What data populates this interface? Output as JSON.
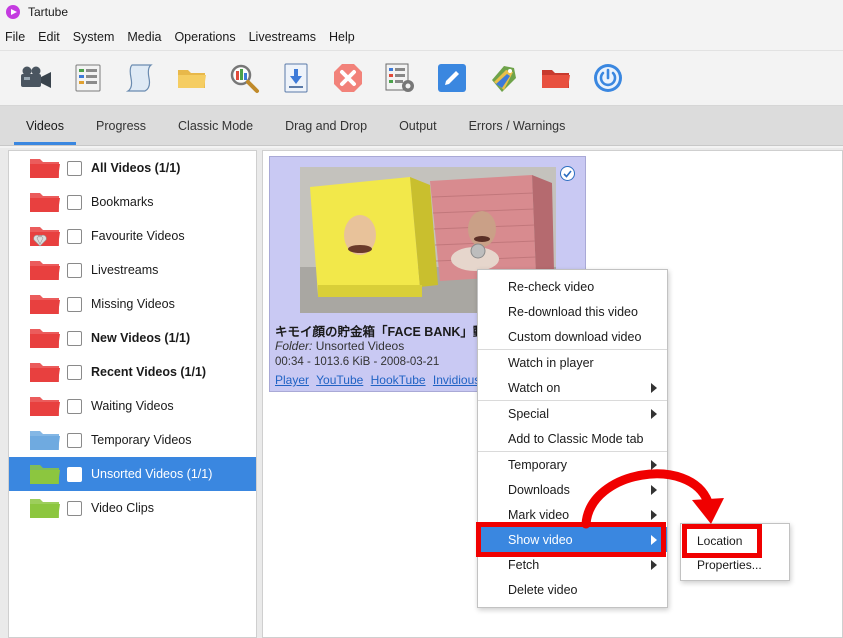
{
  "window": {
    "title": "Tartube"
  },
  "menubar": [
    "File",
    "Edit",
    "System",
    "Media",
    "Operations",
    "Livestreams",
    "Help"
  ],
  "toolbar": [
    {
      "icon": "video-camera-icon"
    },
    {
      "icon": "channel-list-icon"
    },
    {
      "icon": "playlist-scroll-icon"
    },
    {
      "icon": "folder-icon"
    },
    {
      "icon": "search-magnifier-icon"
    },
    {
      "icon": "download-icon"
    },
    {
      "icon": "stop-icon"
    },
    {
      "icon": "settings-sheet-icon"
    },
    {
      "icon": "edit-pencil-icon"
    },
    {
      "icon": "tags-icon"
    },
    {
      "icon": "red-folder-icon"
    },
    {
      "icon": "power-icon"
    }
  ],
  "tabs": [
    "Videos",
    "Progress",
    "Classic Mode",
    "Drag and Drop",
    "Output",
    "Errors / Warnings"
  ],
  "sidebar": [
    {
      "label": "All Videos (1/1)",
      "bold": true,
      "color": "#e8403f"
    },
    {
      "label": "Bookmarks",
      "bold": false,
      "color": "#e8403f"
    },
    {
      "label": "Favourite Videos",
      "bold": false,
      "color": "#e8403f"
    },
    {
      "label": "Livestreams",
      "bold": false,
      "color": "#e8403f"
    },
    {
      "label": "Missing Videos",
      "bold": false,
      "color": "#e8403f"
    },
    {
      "label": "New Videos (1/1)",
      "bold": true,
      "color": "#e8403f"
    },
    {
      "label": "Recent Videos (1/1)",
      "bold": true,
      "color": "#e8403f"
    },
    {
      "label": "Waiting Videos",
      "bold": false,
      "color": "#e8403f"
    },
    {
      "label": "Temporary Videos",
      "bold": false,
      "color": "#6faae0"
    },
    {
      "label": "Unsorted Videos (1/1)",
      "bold": false,
      "color": "#8cc63f",
      "selected": true
    },
    {
      "label": "Video Clips",
      "bold": false,
      "color": "#8cc63f"
    }
  ],
  "video": {
    "title": "キモイ顔の貯金箱「FACE BANK」動",
    "folder_label": "Folder:",
    "folder_value": "Unsorted Videos",
    "meta": "00:34  -  1013.6 KiB  -  2008-03-21",
    "links": [
      "Player",
      "YouTube",
      "HookTube",
      "Invidious"
    ]
  },
  "context_menu": {
    "groups": [
      [
        {
          "label": "Re-check video"
        },
        {
          "label": "Re-download this video"
        },
        {
          "label": "Custom download video"
        }
      ],
      [
        {
          "label": "Watch in player"
        },
        {
          "label": "Watch on",
          "submenu": true
        }
      ],
      [
        {
          "label": "Special",
          "submenu": true
        },
        {
          "label": "Add to Classic Mode tab"
        }
      ],
      [
        {
          "label": "Temporary",
          "submenu": true
        },
        {
          "label": "Downloads",
          "submenu": true
        },
        {
          "label": "Mark video",
          "submenu": true
        },
        {
          "label": "Show video",
          "submenu": true,
          "highlighted": true
        },
        {
          "label": "Fetch",
          "submenu": true
        },
        {
          "label": "Delete video"
        }
      ]
    ]
  },
  "submenu": [
    "Location",
    "Properties..."
  ],
  "annotation_color": "#f00000",
  "highlight_color": "#3a87e0"
}
